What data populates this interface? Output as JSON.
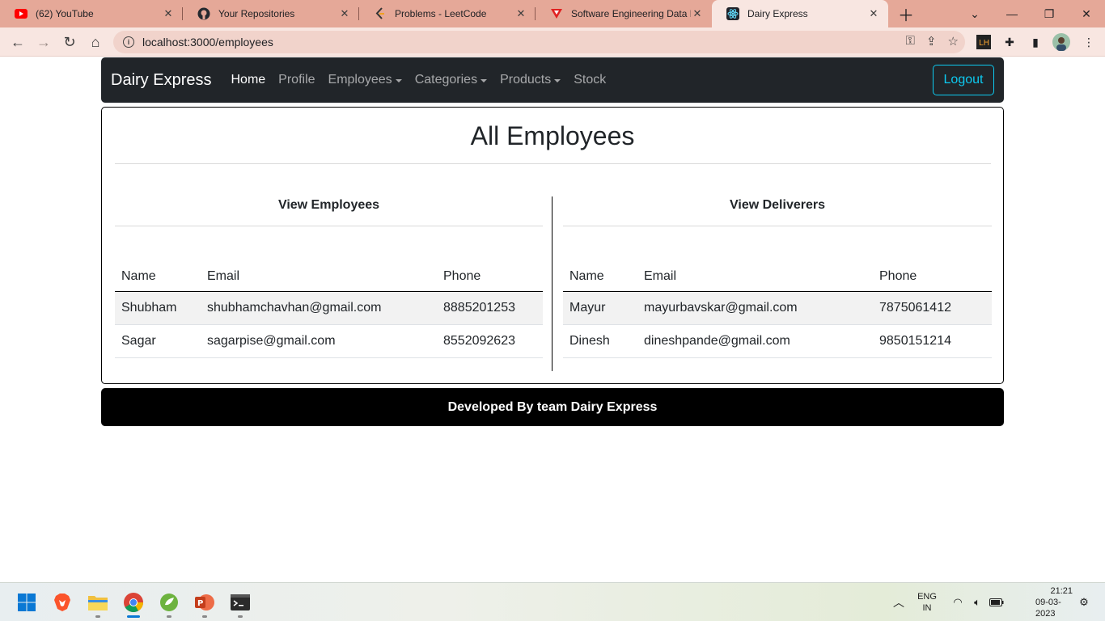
{
  "browser": {
    "tabs": [
      {
        "title": "(62) YouTube",
        "icon": "youtube-icon"
      },
      {
        "title": "Your Repositories",
        "icon": "github-icon"
      },
      {
        "title": "Problems - LeetCode",
        "icon": "leetcode-icon"
      },
      {
        "title": "Software Engineering Data Fl",
        "icon": "vercel-icon"
      },
      {
        "title": "Dairy Express",
        "icon": "react-icon",
        "active": true
      }
    ],
    "url": "localhost:3000/employees"
  },
  "navbar": {
    "brand": "Dairy Express",
    "links": [
      "Home",
      "Profile",
      "Employees",
      "Categories",
      "Products",
      "Stock"
    ],
    "logout": "Logout"
  },
  "page": {
    "title": "All Employees",
    "employees": {
      "heading": "View Employees",
      "columns": [
        "Name",
        "Email",
        "Phone"
      ],
      "rows": [
        [
          "Shubham",
          "shubhamchavhan@gmail.com",
          "8885201253"
        ],
        [
          "Sagar",
          "sagarpise@gmail.com",
          "8552092623"
        ]
      ]
    },
    "deliverers": {
      "heading": "View Deliverers",
      "columns": [
        "Name",
        "Email",
        "Phone"
      ],
      "rows": [
        [
          "Mayur",
          "mayurbavskar@gmail.com",
          "7875061412"
        ],
        [
          "Dinesh",
          "dineshpande@gmail.com",
          "9850151214"
        ]
      ]
    }
  },
  "footer": {
    "text": "Developed By team Dairy Express"
  },
  "taskbar": {
    "lang_top": "ENG",
    "lang_bottom": "IN",
    "time": "21:21",
    "date": "09-03-2023"
  },
  "colors": {
    "accent": "#0dcaf0",
    "navbar": "#212529",
    "tabstrip": "#e5a898"
  }
}
